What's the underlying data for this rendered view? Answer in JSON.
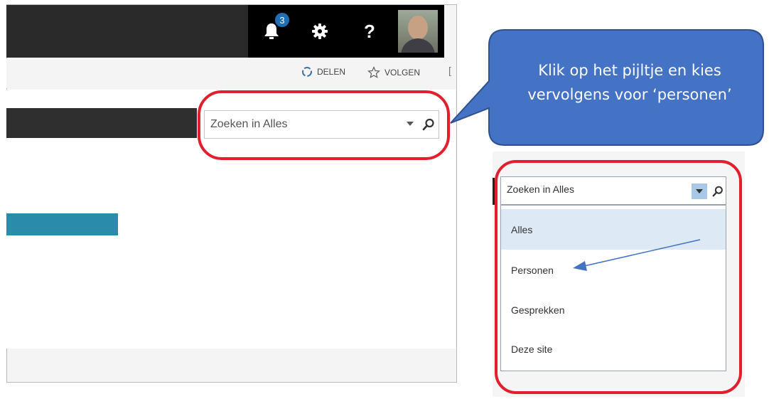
{
  "suite_bar": {
    "notification_count": "3",
    "help_label": "?"
  },
  "toolbar": {
    "share_label": "DELEN",
    "follow_label": "VOLGEN",
    "focus_fragment": "["
  },
  "search": {
    "placeholder": "Zoeken in Alles"
  },
  "callout": {
    "line1": "Klik op het pijltje en kies",
    "line2": "vervolgens voor ‘personen’",
    "color": "#4472c4"
  },
  "dropdown": {
    "input_value": "Zoeken in Alles",
    "options": [
      {
        "label": "Alles",
        "selected": true
      },
      {
        "label": "Personen",
        "selected": false
      },
      {
        "label": "Gesprekken",
        "selected": false
      },
      {
        "label": "Deze site",
        "selected": false
      }
    ]
  },
  "colors": {
    "highlight_oval": "#e1202f",
    "accent_bar": "#2a8bab",
    "selected_option": "#ddeaf6",
    "caret_button": "#a7c8e6",
    "arrow": "#4472c4"
  }
}
